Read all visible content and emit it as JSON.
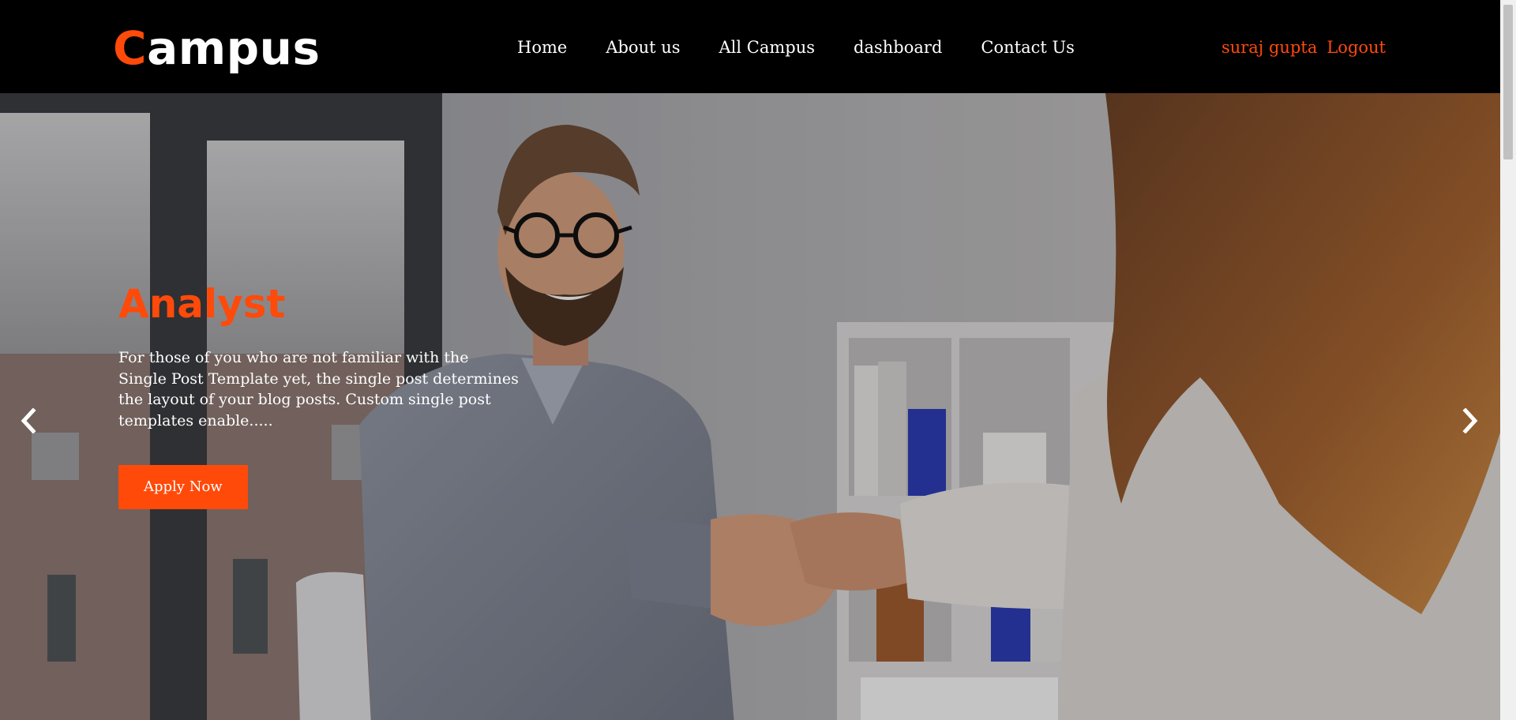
{
  "header": {
    "logo_first": "C",
    "logo_rest": "ampus",
    "nav": [
      "Home",
      "About us",
      "All Campus",
      "dashboard",
      "Contact Us"
    ],
    "user_name": "suraj gupta",
    "logout_label": "Logout"
  },
  "hero": {
    "title": "Analyst",
    "text": "For those of you who are not familiar with the Single Post Template yet, the single post determines the layout of your blog posts. Custom single post templates enable.....",
    "button_label": "Apply Now",
    "image_desc": "handshake-office-photo"
  },
  "colors": {
    "accent": "#ff4a0a",
    "header_bg": "#000000",
    "text_light": "#ffffff"
  },
  "icons": {
    "prev": "chevron-left-icon",
    "next": "chevron-right-icon"
  }
}
